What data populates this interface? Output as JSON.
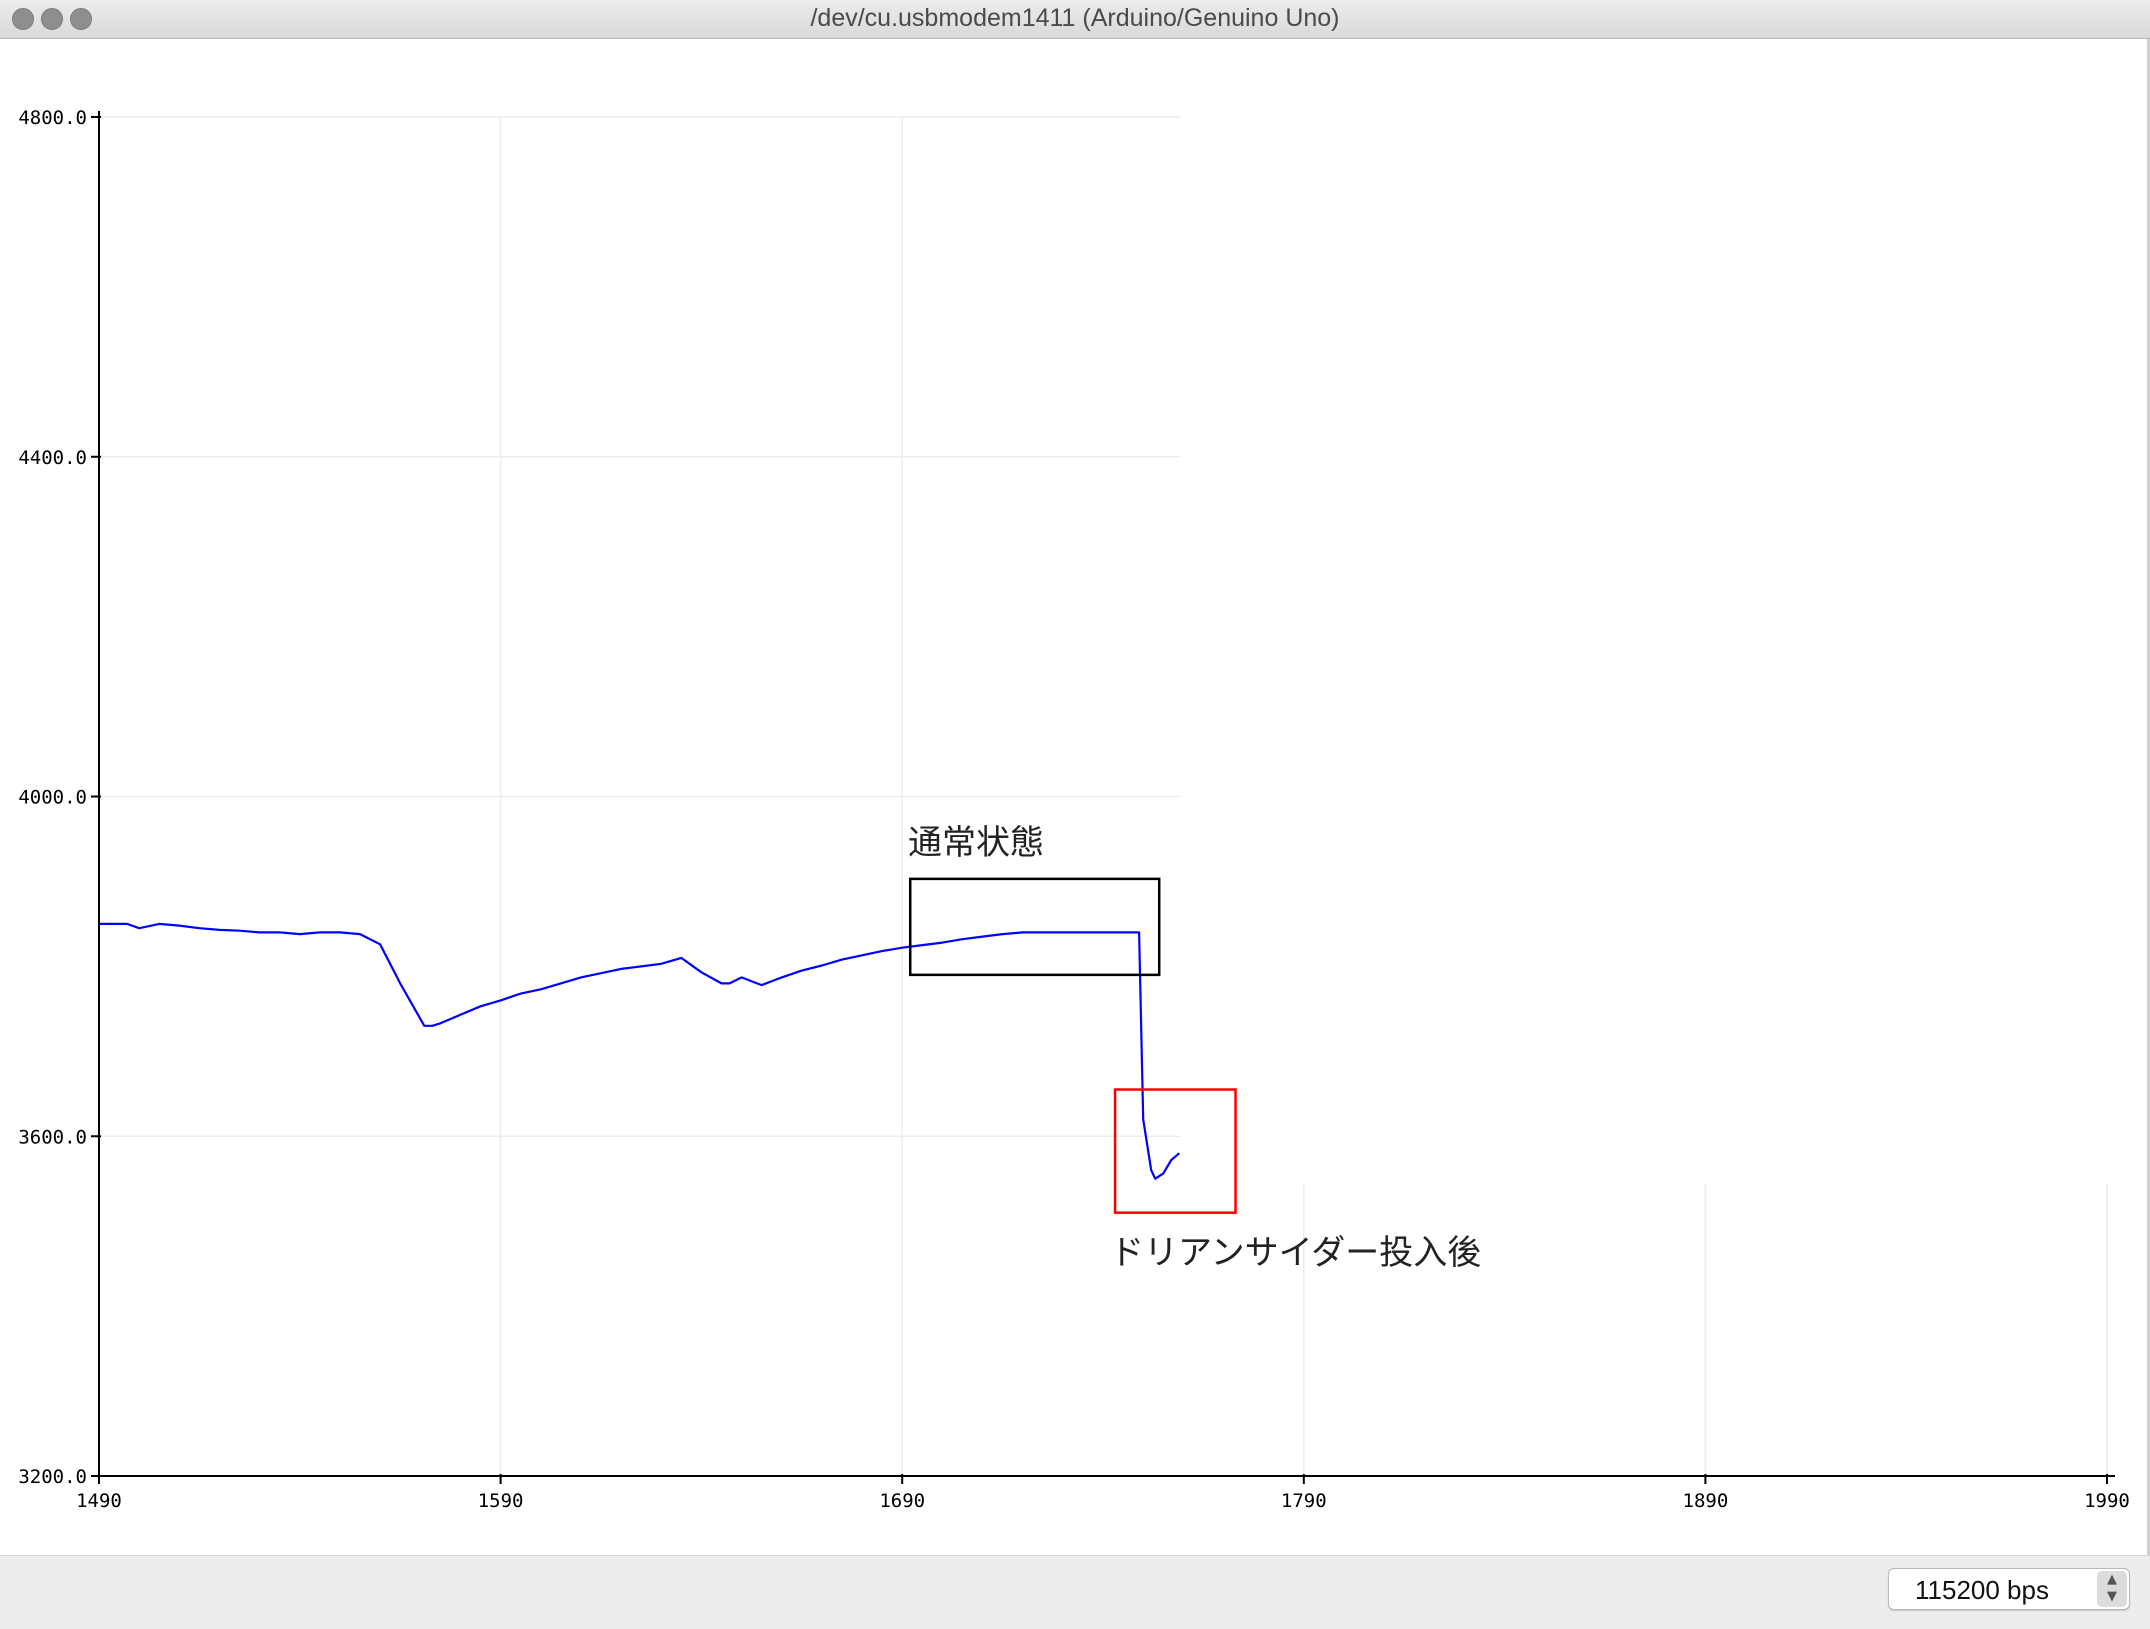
{
  "window": {
    "title": "/dev/cu.usbmodem1411 (Arduino/Genuino Uno)"
  },
  "footer": {
    "baud_rate": "115200 bps",
    "stepper_up": "▲",
    "stepper_down": "▼"
  },
  "annotations": {
    "normal_label": "通常状態",
    "after_label": "ドリアンサイダー投入後",
    "normal_box_color": "#000000",
    "after_box_color": "#ff0000"
  },
  "chart_data": {
    "type": "line",
    "title": "",
    "xlabel": "",
    "ylabel": "",
    "xlim": [
      1490,
      1990
    ],
    "ylim": [
      3200,
      4800
    ],
    "x_ticks": [
      "1490",
      "1590",
      "1690",
      "1790",
      "1890",
      "1990"
    ],
    "y_ticks": [
      "3200.0",
      "3600.0",
      "4000.0",
      "4400.0",
      "4800.0"
    ],
    "grid": true,
    "series": [
      {
        "color": "#0000ff",
        "x": [
          1490,
          1497,
          1500,
          1505,
          1510,
          1515,
          1520,
          1525,
          1530,
          1535,
          1540,
          1545,
          1550,
          1555,
          1560,
          1565,
          1568,
          1571,
          1573,
          1575,
          1580,
          1585,
          1590,
          1595,
          1600,
          1605,
          1610,
          1615,
          1620,
          1625,
          1630,
          1635,
          1640,
          1645,
          1647,
          1650,
          1655,
          1660,
          1665,
          1670,
          1675,
          1680,
          1685,
          1690,
          1695,
          1700,
          1705,
          1710,
          1715,
          1720,
          1725,
          1730,
          1735,
          1740,
          1744,
          1749,
          1750,
          1752,
          1753,
          1755,
          1757,
          1759
        ],
        "y": [
          3850,
          3850,
          3845,
          3850,
          3848,
          3845,
          3843,
          3842,
          3840,
          3840,
          3838,
          3840,
          3840,
          3838,
          3826,
          3780,
          3755,
          3730,
          3730,
          3733,
          3743,
          3753,
          3760,
          3768,
          3773,
          3780,
          3787,
          3792,
          3797,
          3800,
          3803,
          3810,
          3793,
          3780,
          3780,
          3787,
          3778,
          3787,
          3795,
          3801,
          3808,
          3813,
          3818,
          3822,
          3825,
          3828,
          3832,
          3835,
          3838,
          3840,
          3840,
          3840,
          3840,
          3840,
          3840,
          3840,
          3620,
          3560,
          3550,
          3556,
          3572,
          3580
        ]
      }
    ],
    "annotation_boxes": [
      {
        "label": "通常状態",
        "x": [
          1692,
          1754
        ],
        "y": [
          3790,
          3903
        ],
        "color": "#000000"
      },
      {
        "label": "ドリアンサイダー投入後",
        "x": [
          1743,
          1773
        ],
        "y": [
          3510,
          3655
        ],
        "color": "#ff0000"
      }
    ]
  }
}
